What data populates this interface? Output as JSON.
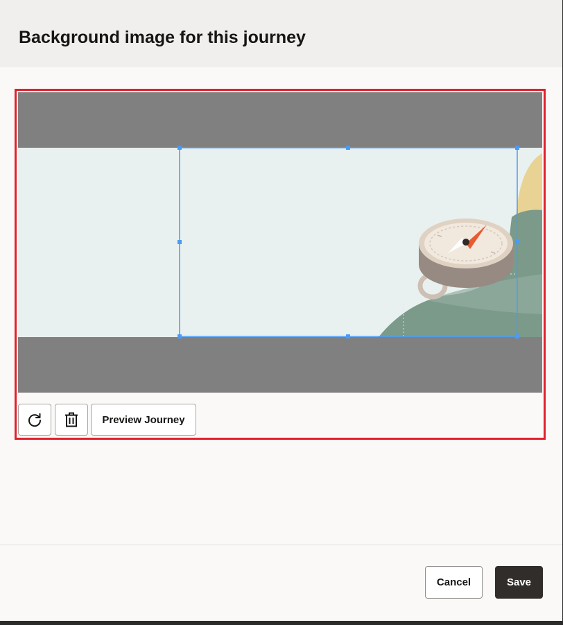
{
  "dialog": {
    "title": "Background image for this journey"
  },
  "editor": {
    "rotate_icon": "rotate-clockwise-icon",
    "delete_icon": "trash-icon",
    "preview_label": "Preview Journey"
  },
  "footer": {
    "cancel_label": "Cancel",
    "save_label": "Save"
  },
  "colors": {
    "frame_highlight": "#e0212b",
    "crop_selection": "#4a9bf5",
    "letterbox": "#808080",
    "image_background": "#e9f1f0",
    "primary_button": "#312d2a"
  }
}
